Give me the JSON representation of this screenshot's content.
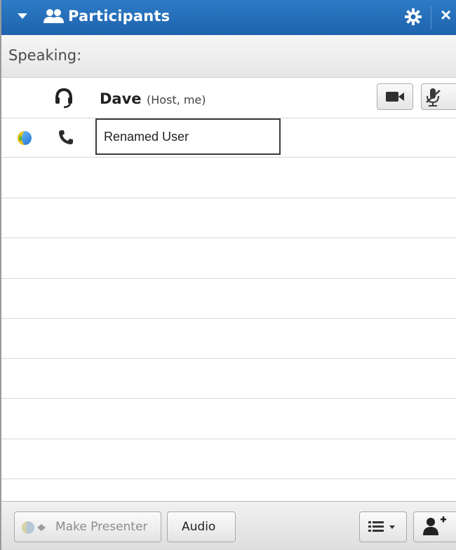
{
  "panel": {
    "title": "Participants",
    "speaking_label": "Speaking:"
  },
  "participants": [
    {
      "name": "Dave",
      "role": "(Host, me)",
      "connection_icon": "headset-icon"
    },
    {
      "name_edit_value": "Renamed User",
      "status_icon": "globe-icon",
      "connection_icon": "phone-icon"
    }
  ],
  "footer": {
    "make_presenter_label": "Make Presenter",
    "audio_label": "Audio"
  },
  "colors": {
    "titlebar": "#1f63ad",
    "title_text": "#ffffff",
    "row_line": "#d8d8d8"
  }
}
